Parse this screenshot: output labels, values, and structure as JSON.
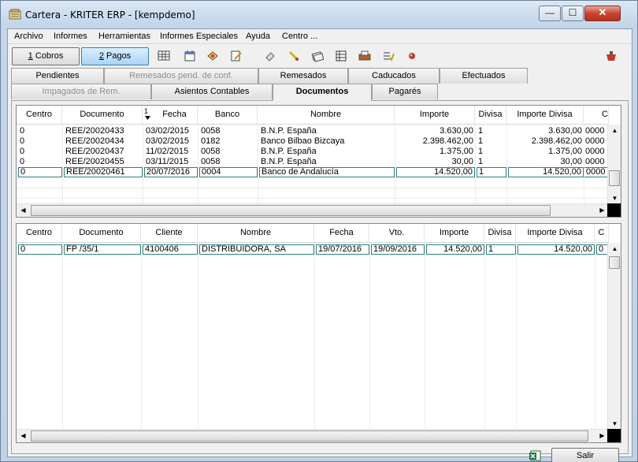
{
  "window": {
    "title": "Cartera - KRITER ERP - [kempdemo]",
    "min_glyph": "—",
    "max_glyph": "☐",
    "close_glyph": "✕"
  },
  "menu": [
    "Archivo",
    "Informes",
    "Herramientas",
    "Informes Especiales",
    "Ayuda",
    "Centro ..."
  ],
  "toolbar": {
    "cobros_num": "1",
    "cobros_label": " Cobros",
    "pagos_num": "2",
    "pagos_label": " Pagos",
    "icons": [
      "grid-icon",
      "calendar-icon",
      "document-icon",
      "edit-icon",
      "eraser-icon",
      "marker-icon",
      "checks-icon",
      "table-icon",
      "printer-icon",
      "list-check-icon",
      "pin-icon",
      "exit-icon"
    ]
  },
  "tabs_row1": [
    {
      "label": "Pendientes",
      "state": "normal"
    },
    {
      "label": "Remesados pend. de conf.",
      "state": "disabled"
    },
    {
      "label": "Remesados",
      "state": "normal"
    },
    {
      "label": "Caducados",
      "state": "normal"
    },
    {
      "label": "Efectuados",
      "state": "normal"
    }
  ],
  "tabs_row2": [
    {
      "label": "Impagados de Rem.",
      "state": "disabled"
    },
    {
      "label": "Asientos Contables",
      "state": "normal"
    },
    {
      "label": "Documentos",
      "state": "selected"
    },
    {
      "label": "Pagarés",
      "state": "normal"
    }
  ],
  "grid1": {
    "sort_indicator": "1",
    "columns": [
      "Centro",
      "Documento",
      "Fecha",
      "Banco",
      "Nombre",
      "Importe",
      "Divisa",
      "Importe Divisa",
      "C"
    ],
    "rows": [
      [
        "0",
        "REE/20020433",
        "03/02/2015",
        "0058",
        "B.N.P. España",
        "3.630,00",
        "1",
        "3.630,00",
        "0000"
      ],
      [
        "0",
        "REE/20020434",
        "03/02/2015",
        "0182",
        "Banco Bilbao Bizcaya",
        "2.398.462,00",
        "1",
        "2.398.462,00",
        "0000"
      ],
      [
        "0",
        "REE/20020437",
        "11/02/2015",
        "0058",
        "B.N.P. España",
        "1.375,00",
        "1",
        "1.375,00",
        "0000"
      ],
      [
        "0",
        "REE/20020455",
        "03/11/2015",
        "0058",
        "B.N.P. España",
        "30,00",
        "1",
        "30,00",
        "0000"
      ],
      [
        "0",
        "REE/20020461",
        "20/07/2016",
        "0004",
        "Banco de Andalucía",
        "14.520,00",
        "1",
        "14.520,00",
        "0000"
      ]
    ],
    "selected_row": 4
  },
  "grid2": {
    "columns": [
      "Centro",
      "Documento",
      "Cliente",
      "Nombre",
      "Fecha",
      "Vto.",
      "Importe",
      "Divisa",
      "Importe Divisa",
      "C"
    ],
    "rows": [
      [
        "0",
        "FP /35/1",
        "4100406",
        "DISTRIBUIDORA, SA",
        "19/07/2016",
        "19/09/2016",
        "14.520,00",
        "1",
        "14.520,00",
        "0"
      ]
    ],
    "selected_row": 0
  },
  "footer": {
    "salir_label": "Salir",
    "export_icon": "excel-export-icon"
  },
  "colors": {
    "title_bg": "#bcd3ea",
    "selected_row_border": "#2f7f7f",
    "pagos_active": "#a9d3f7"
  }
}
